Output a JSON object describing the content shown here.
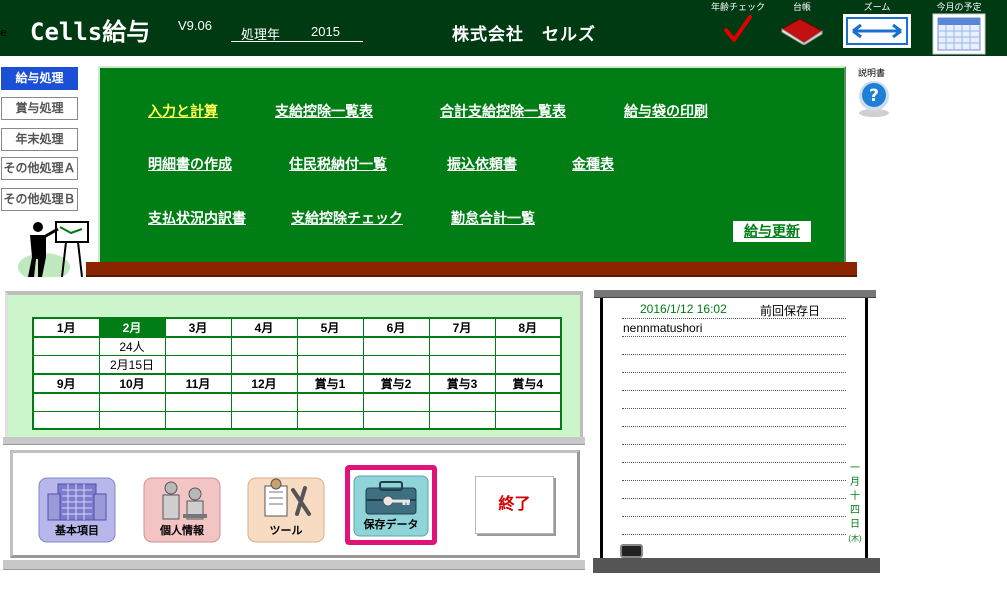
{
  "header": {
    "edge_fragment": "e",
    "app_title": "Cells給与",
    "version": "V9.06",
    "year_label": "処理年",
    "year_value": "2015",
    "company": "株式会社　セルズ",
    "tools": [
      {
        "label": "年齢チェック",
        "icon": "checkmark-icon"
      },
      {
        "label": "台帳",
        "icon": "ledger-book-icon"
      },
      {
        "label": "ズーム",
        "icon": "zoom-arrows-icon"
      },
      {
        "label": "今月の予定",
        "icon": "calendar-icon"
      }
    ]
  },
  "left_menu": [
    {
      "label": "給与処理",
      "active": true
    },
    {
      "label": "賞与処理",
      "active": false
    },
    {
      "label": "年末処理",
      "active": false
    },
    {
      "label": "その他処理Ａ",
      "active": false
    },
    {
      "label": "その他処理Ｂ",
      "active": false
    }
  ],
  "board": {
    "row1": [
      "入力と計算",
      "支給控除一覧表",
      "合計支給控除一覧表",
      "給与袋の印刷"
    ],
    "row2": [
      "明細書の作成",
      "住民税納付一覧",
      "振込依頼書",
      "金種表"
    ],
    "row3": [
      "支払状況内訳書",
      "支給控除チェック",
      "勤怠合計一覧"
    ],
    "update_button": "給与更新"
  },
  "help": {
    "label": "説明書",
    "icon": "help-question-icon"
  },
  "calendar": {
    "months_top": [
      "1月",
      "2月",
      "3月",
      "4月",
      "5月",
      "6月",
      "7月",
      "8月"
    ],
    "current_index": 1,
    "current_count": "24人",
    "current_date": "2月15日",
    "months_bottom": [
      "9月",
      "10月",
      "11月",
      "12月",
      "賞与1",
      "賞与2",
      "賞与3",
      "賞与4"
    ]
  },
  "buttons": {
    "basic": {
      "label": "基本項目",
      "icon": "building-icon"
    },
    "personal": {
      "label": "個人情報",
      "icon": "people-icon"
    },
    "tools": {
      "label": "ツール",
      "icon": "tools-icon"
    },
    "saved": {
      "label": "保存データ",
      "icon": "toolbox-key-icon"
    },
    "end": {
      "label": "終了"
    }
  },
  "memo": {
    "saved_datetime": "2016/1/12 16:02",
    "saved_label": "前回保存日",
    "text": "nennmatushori",
    "vertical_date": [
      "一",
      "月",
      "十",
      "四",
      "日",
      "(木)"
    ]
  },
  "colors": {
    "header_bg": "#003a12",
    "board_green": "#007d14",
    "menu_active": "#1a4fd6",
    "board_base": "#8a2500",
    "highlight_frame": "#e0137a",
    "end_text": "#d40000"
  }
}
